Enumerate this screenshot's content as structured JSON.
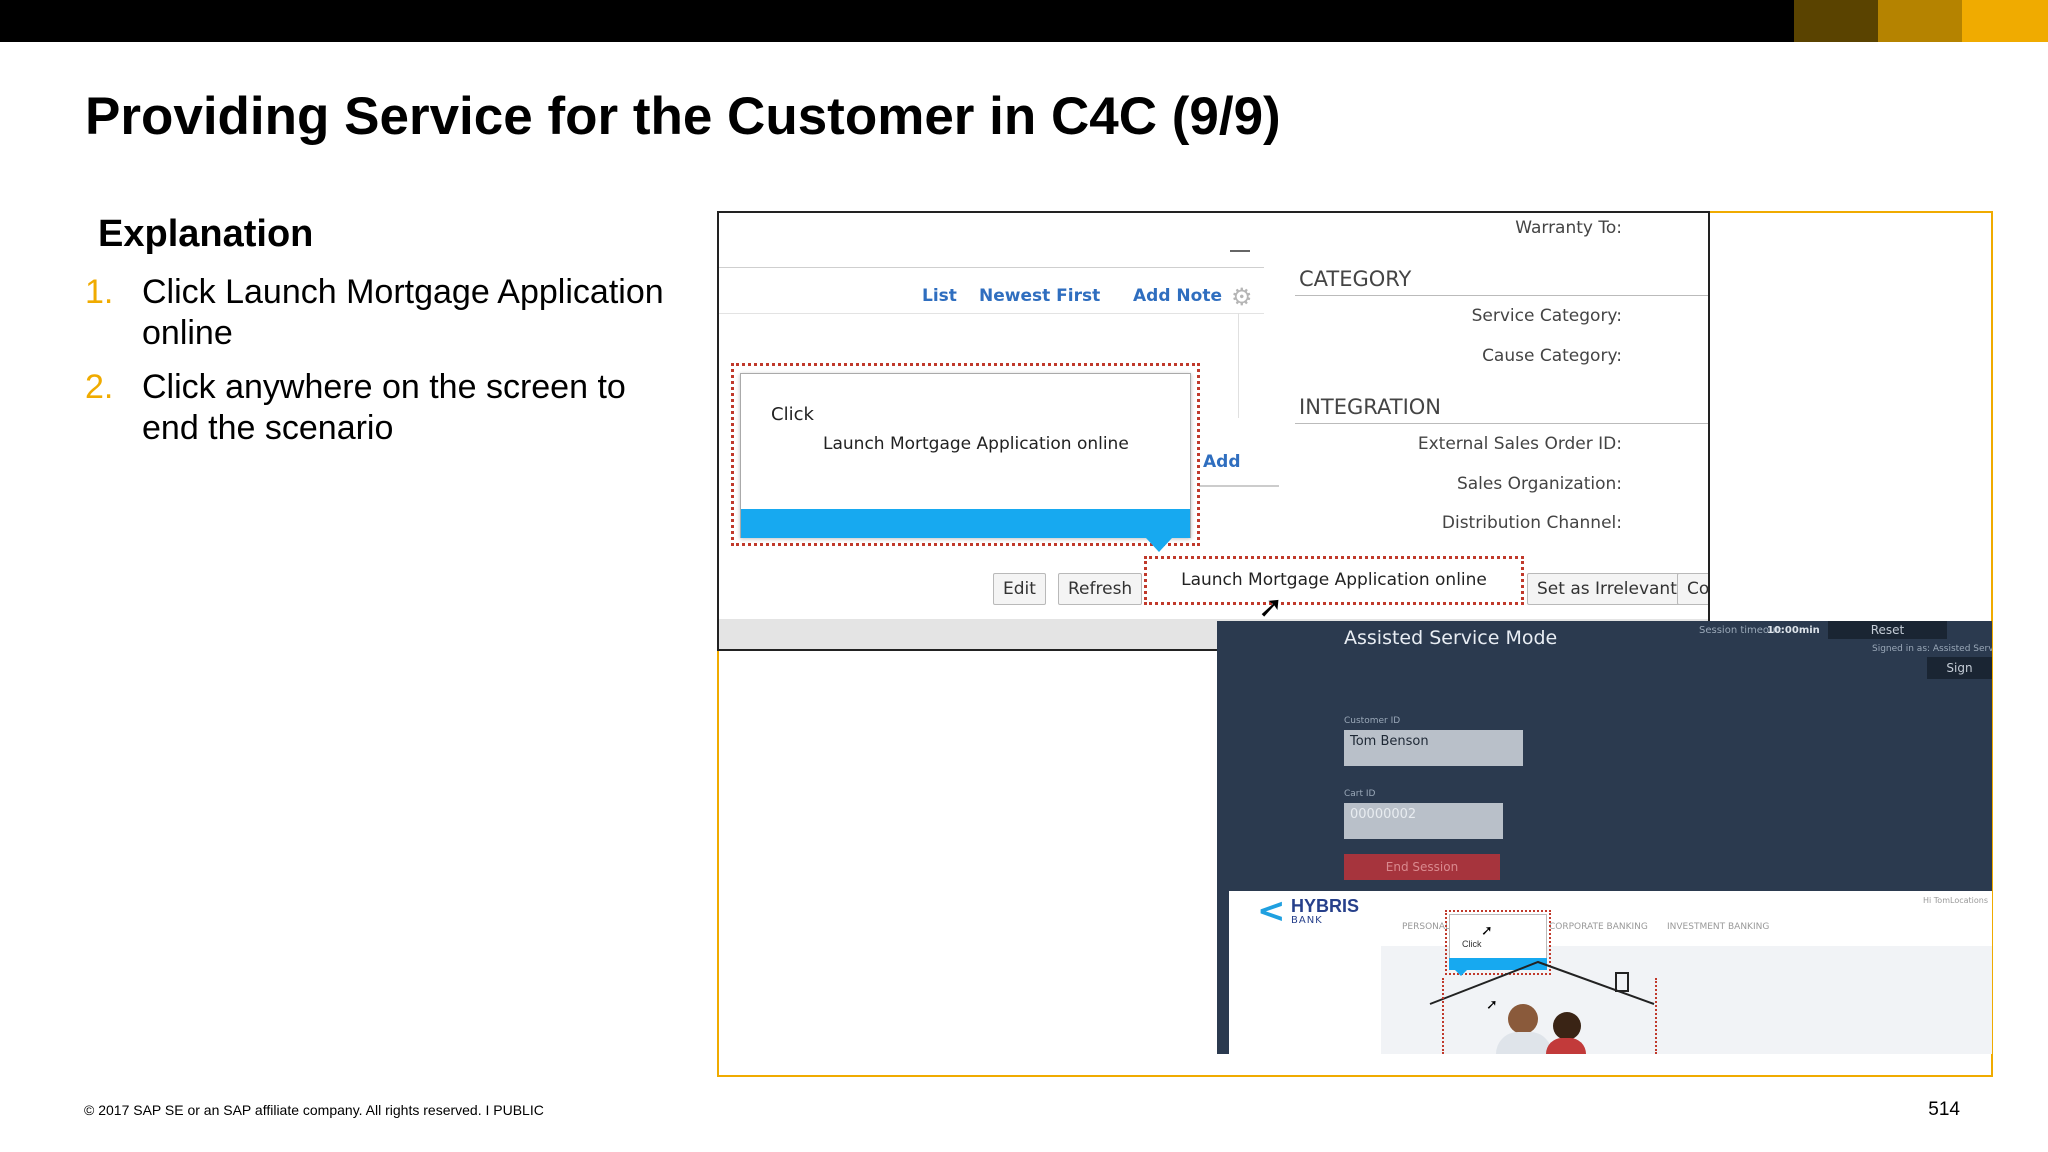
{
  "slide": {
    "title": "Providing Service for the Customer in C4C (9/9)",
    "explanation_heading": "Explanation",
    "steps": [
      {
        "num": "1.",
        "text": "Click Launch Mortgage Application online"
      },
      {
        "num": "2.",
        "text": "Click anywhere on the screen to end the scenario"
      }
    ],
    "footer": "© 2017 SAP SE or an SAP affiliate company. All rights reserved.  I   PUBLIC",
    "page_number": "514",
    "colors": {
      "accent": "#f0ab00",
      "topbar": "#000000",
      "highlight_blue": "#17a9f0",
      "callout_red": "#c0392b"
    }
  },
  "c4c": {
    "toolbar_links": [
      "List",
      "Newest First",
      "Add Note"
    ],
    "add_link": "Add",
    "warranty_label": "Warranty To:",
    "category_section": "CATEGORY",
    "category_fields": [
      "Service Category:",
      "Cause Category:"
    ],
    "integration_section": "INTEGRATION",
    "integration_fields": [
      "External Sales Order ID:",
      "Sales Organization:",
      "Distribution Channel:"
    ],
    "buttons": {
      "edit": "Edit",
      "refresh": "Refresh",
      "set_irrelevant": "Set as Irrelevant",
      "co": "Co"
    },
    "launch_button": "Launch Mortgage Application online",
    "icons": {
      "gear": "gear-icon",
      "cursor": "pointer-cursor-icon"
    }
  },
  "callout": {
    "label": "Click",
    "text": "Launch Mortgage Application online"
  },
  "asm": {
    "title": "Assisted Service Mode",
    "session_timeout_label": "Session timeout:",
    "session_timeout_value": "10:00min",
    "reset": "Reset",
    "signed_in": "Signed in as: Assisted Servi",
    "sign": "Sign",
    "customer_id_label": "Customer ID",
    "customer_id_value": "Tom Benson",
    "cart_id_label": "Cart ID",
    "cart_id_value": "00000002",
    "end_session": "End Session"
  },
  "bank": {
    "logo": "HYBRIS",
    "logo_sub": "BANK",
    "nav": [
      "PERSONAL",
      "CORPORATE BANKING",
      "INVESTMENT BANKING"
    ],
    "greeting": "Hi TomLocations",
    "mini_callout": "Click"
  }
}
